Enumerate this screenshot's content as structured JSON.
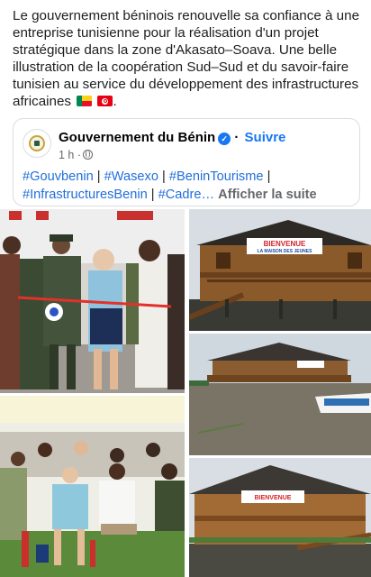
{
  "post": {
    "caption": "Le gouvernement béninois renouvelle sa confiance à une entreprise tunisienne pour la réalisation d'un projet stratégique dans la zone d'Akasato–Soava. Une belle illustration de la coopération Sud–Sud et du savoir-faire tunisien au service du développement des infrastructures africaines",
    "caption_end": "."
  },
  "shared": {
    "page_name": "Gouvernement du Bénin",
    "follow_label": "Suivre",
    "time": "1 h ·",
    "hashtags": [
      "#Gouvbenin",
      "#Wasexo",
      "#BeninTourisme",
      "#InfrastructuresBenin",
      "#Cadre…"
    ],
    "separator": "|",
    "see_more": "Afficher la suite"
  },
  "photos": {
    "sign_line1": "BIENVENUE",
    "sign_line2": "LA MAISON DES JEUNES",
    "sign_small": "BIENVENUE"
  },
  "icons": {
    "verified": "verified-badge-icon",
    "audience": "globe-icon",
    "flag1": "benin-flag-icon",
    "flag2": "tunisia-flag-icon"
  },
  "colors": {
    "link": "#216fdb",
    "accent": "#1877f2",
    "muted": "#65676b"
  }
}
